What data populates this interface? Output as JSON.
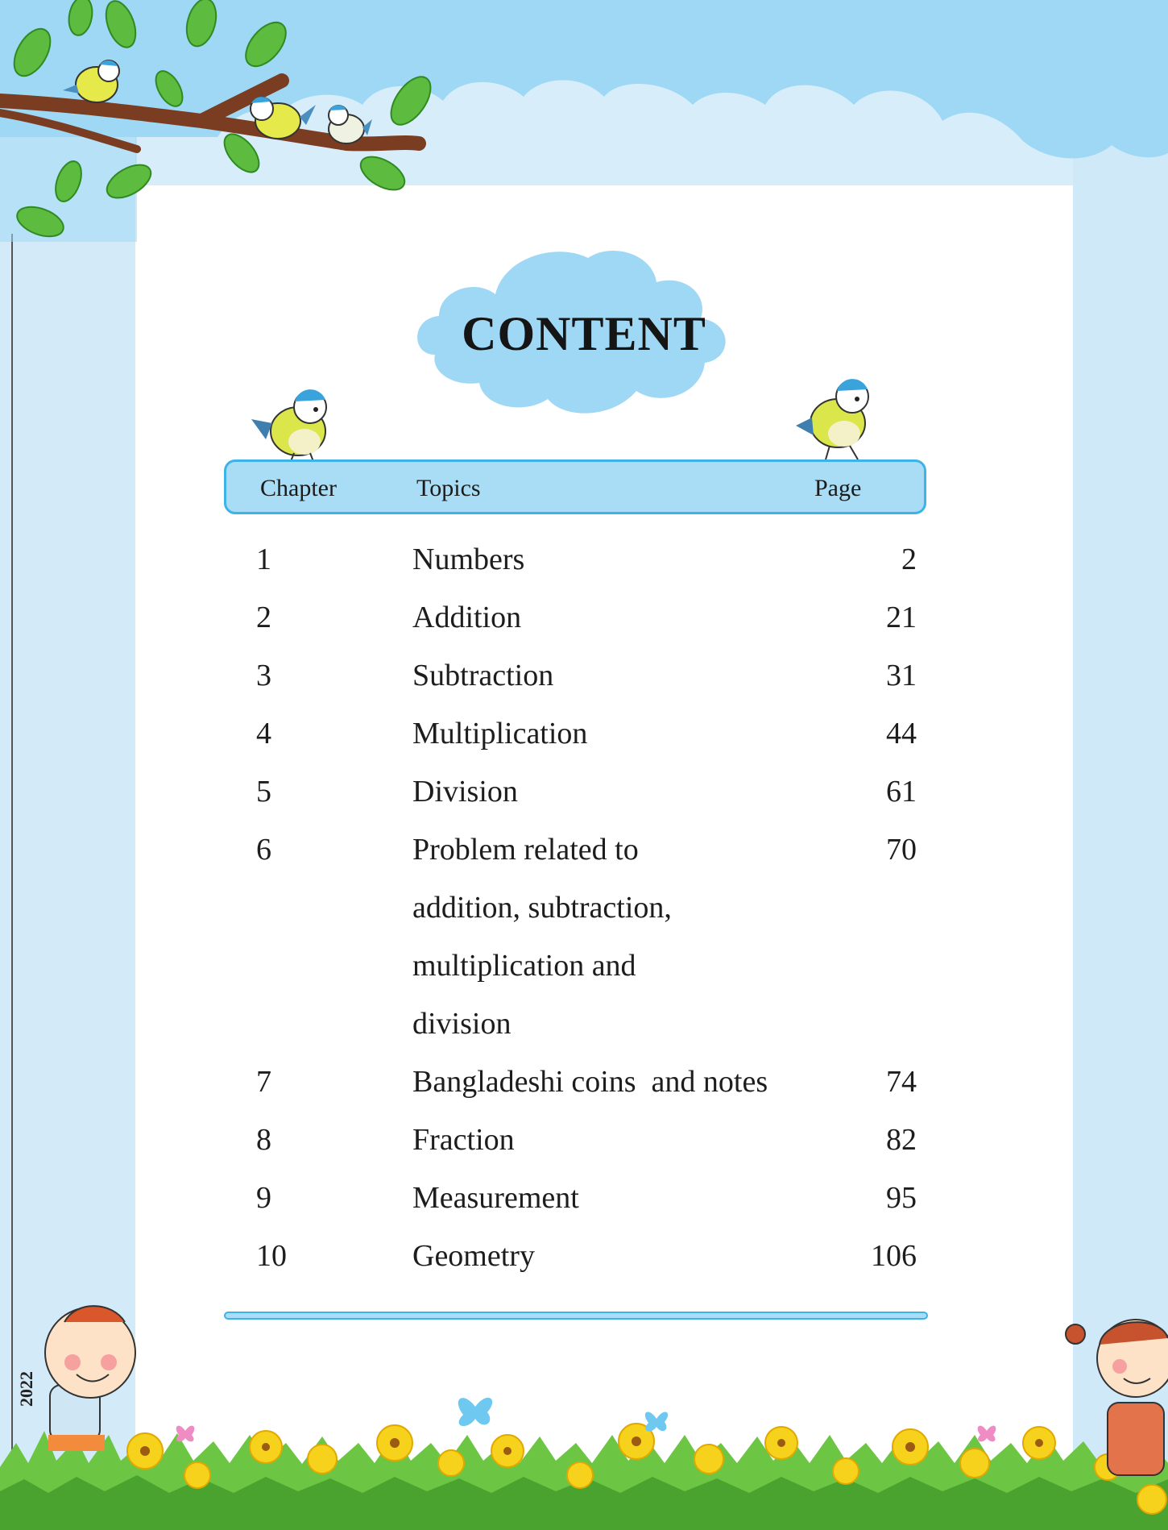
{
  "year": "2022",
  "title": "CONTENT",
  "header": {
    "chapter": "Chapter",
    "topics": "Topics",
    "page": "Page"
  },
  "rows": [
    {
      "chapter": "1",
      "topic_lines": [
        "Numbers"
      ],
      "page": "2"
    },
    {
      "chapter": "2",
      "topic_lines": [
        "Addition"
      ],
      "page": "21"
    },
    {
      "chapter": "3",
      "topic_lines": [
        "Subtraction"
      ],
      "page": "31"
    },
    {
      "chapter": "4",
      "topic_lines": [
        "Multiplication"
      ],
      "page": "44"
    },
    {
      "chapter": "5",
      "topic_lines": [
        "Division"
      ],
      "page": "61"
    },
    {
      "chapter": "6",
      "topic_lines": [
        "Problem related to",
        "addition, subtraction,",
        "multiplication and",
        "division"
      ],
      "page": "70"
    },
    {
      "chapter": "7",
      "topic_lines": [
        "Bangladeshi coins  and notes"
      ],
      "page": "74"
    },
    {
      "chapter": "8",
      "topic_lines": [
        "Fraction"
      ],
      "page": "82"
    },
    {
      "chapter": "9",
      "topic_lines": [
        "Measurement"
      ],
      "page": "95"
    },
    {
      "chapter": "10",
      "topic_lines": [
        "Geometry"
      ],
      "page": "106"
    }
  ],
  "colors": {
    "sky": "#9fd8f4",
    "accent": "#3fb2e7",
    "header_fill": "#a9dcf5",
    "leaf": "#5dbb3f",
    "branch": "#7a3d22"
  }
}
